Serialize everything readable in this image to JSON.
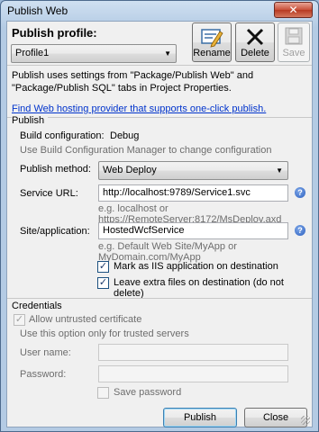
{
  "window": {
    "title": "Publish Web",
    "close_glyph": "✕"
  },
  "profile": {
    "label": "Publish profile:",
    "selected": "Profile1",
    "buttons": [
      {
        "label": "Rename",
        "icon": "rename-icon",
        "enabled": true
      },
      {
        "label": "Delete",
        "icon": "delete-icon",
        "enabled": true
      },
      {
        "label": "Save",
        "icon": "save-icon",
        "enabled": false
      }
    ]
  },
  "info_text": "Publish uses settings from \"Package/Publish Web\" and \"Package/Publish SQL\" tabs in Project Properties.",
  "hosting_link": "Find Web hosting provider that supports one-click publish.",
  "publish_section": {
    "header": "Publish",
    "build_config_label": "Build configuration:",
    "build_config_value": "Debug",
    "build_config_hint": "Use Build Configuration Manager to change configuration",
    "method_label": "Publish method:",
    "method_value": "Web Deploy",
    "service_url_label": "Service URL:",
    "service_url_value": "http://localhost:9789/Service1.svc",
    "service_url_hint": "e.g. localhost or https://RemoteServer:8172/MsDeploy.axd",
    "site_label": "Site/application:",
    "site_value": "HostedWcfService",
    "site_hint": "e.g. Default Web Site/MyApp or MyDomain.com/MyApp",
    "mark_iis_label": "Mark as IIS application on destination",
    "mark_iis_checked": true,
    "leave_extra_label": "Leave extra files on destination (do not delete)",
    "leave_extra_checked": true,
    "help_glyph": "?"
  },
  "credentials_section": {
    "header": "Credentials",
    "allow_untrusted_label": "Allow untrusted certificate",
    "allow_untrusted_checked": true,
    "allow_untrusted_hint": "Use this option only for trusted servers",
    "username_label": "User name:",
    "username_value": "",
    "password_label": "Password:",
    "password_value": "",
    "save_password_label": "Save password",
    "save_password_checked": false
  },
  "footer": {
    "publish_label": "Publish",
    "close_label": "Close"
  },
  "colors": {
    "accent": "#0033cc",
    "title_gradient": "#b4cbe4",
    "close_red": "#c94f38"
  }
}
